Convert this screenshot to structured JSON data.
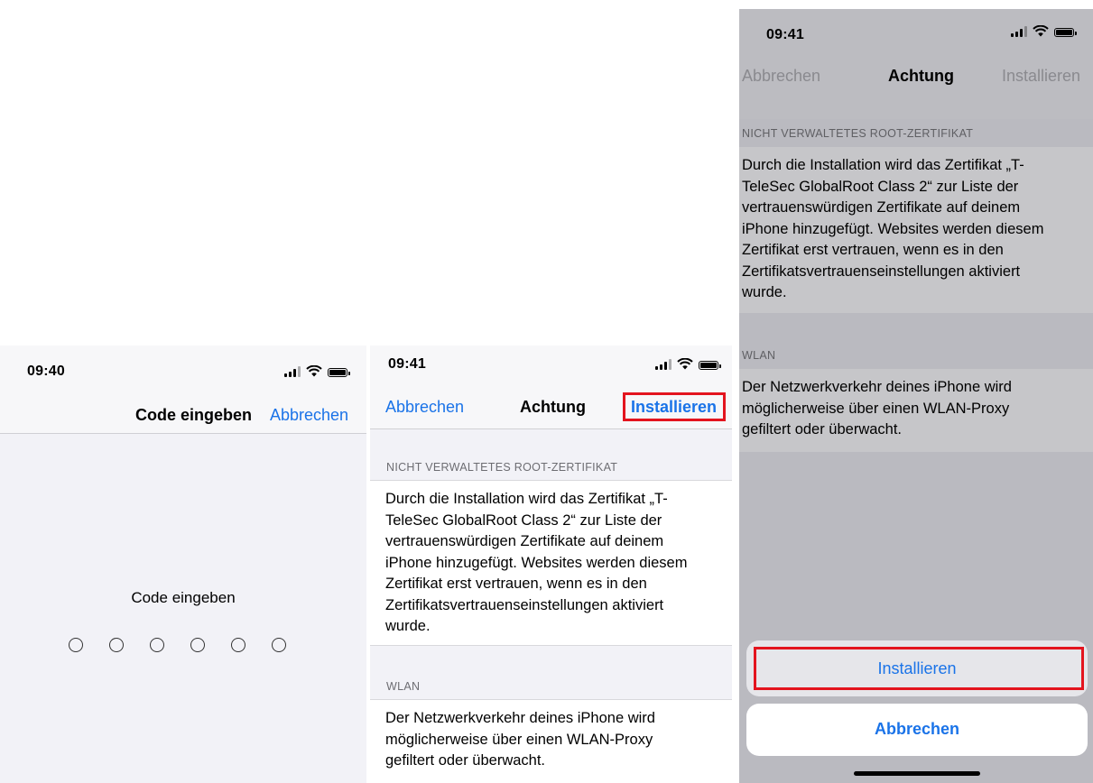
{
  "screen1": {
    "status": {
      "time": "09:40"
    },
    "nav": {
      "title": "Code eingeben",
      "cancel": "Abbrechen"
    },
    "prompt": "Code eingeben",
    "passcode_dots": 6
  },
  "screen2": {
    "status": {
      "time": "09:41"
    },
    "nav": {
      "cancel": "Abbrechen",
      "title": "Achtung",
      "install": "Installieren"
    },
    "sections": [
      {
        "header": "NICHT VERWALTETES ROOT-ZERTIFIKAT",
        "lines": [
          "Durch die Installation wird das Zertifikat „T-",
          "TeleSec GlobalRoot Class 2“ zur Liste der",
          "vertrauenswürdigen Zertifikate auf deinem",
          "iPhone hinzugefügt. Websites werden diesem",
          "Zertifikat erst vertrauen, wenn es in den",
          "Zertifikatsvertrauenseinstellungen aktiviert",
          "wurde."
        ]
      },
      {
        "header": "WLAN",
        "lines": [
          "Der Netzwerkverkehr deines iPhone wird",
          "möglicherweise über einen WLAN-Proxy",
          "gefiltert oder überwacht."
        ]
      }
    ]
  },
  "screen3": {
    "status": {
      "time": "09:41"
    },
    "nav": {
      "cancel": "Abbrechen",
      "title": "Achtung",
      "install": "Installieren"
    },
    "sections": [
      {
        "header": "NICHT VERWALTETES ROOT-ZERTIFIKAT",
        "lines": [
          "Durch die Installation wird das Zertifikat „T-",
          "TeleSec GlobalRoot Class 2“ zur Liste der",
          "vertrauenswürdigen Zertifikate auf deinem",
          "iPhone hinzugefügt. Websites werden diesem",
          "Zertifikat erst vertrauen, wenn es in den",
          "Zertifikatsvertrauenseinstellungen aktiviert",
          "wurde."
        ]
      },
      {
        "header": "WLAN",
        "lines": [
          "Der Netzwerkverkehr deines iPhone wird",
          "möglicherweise über einen WLAN-Proxy",
          "gefiltert oder überwacht."
        ]
      }
    ],
    "action_sheet": {
      "install": "Installieren",
      "cancel": "Abbrechen"
    }
  },
  "colors": {
    "ios_blue": "#1a73e8",
    "highlight_red": "#e3141e",
    "grouped_background": "#f2f2f7",
    "dimmed_background": "#babac0"
  },
  "icons": [
    "cellular-signal-icon",
    "wifi-icon",
    "battery-icon"
  ]
}
